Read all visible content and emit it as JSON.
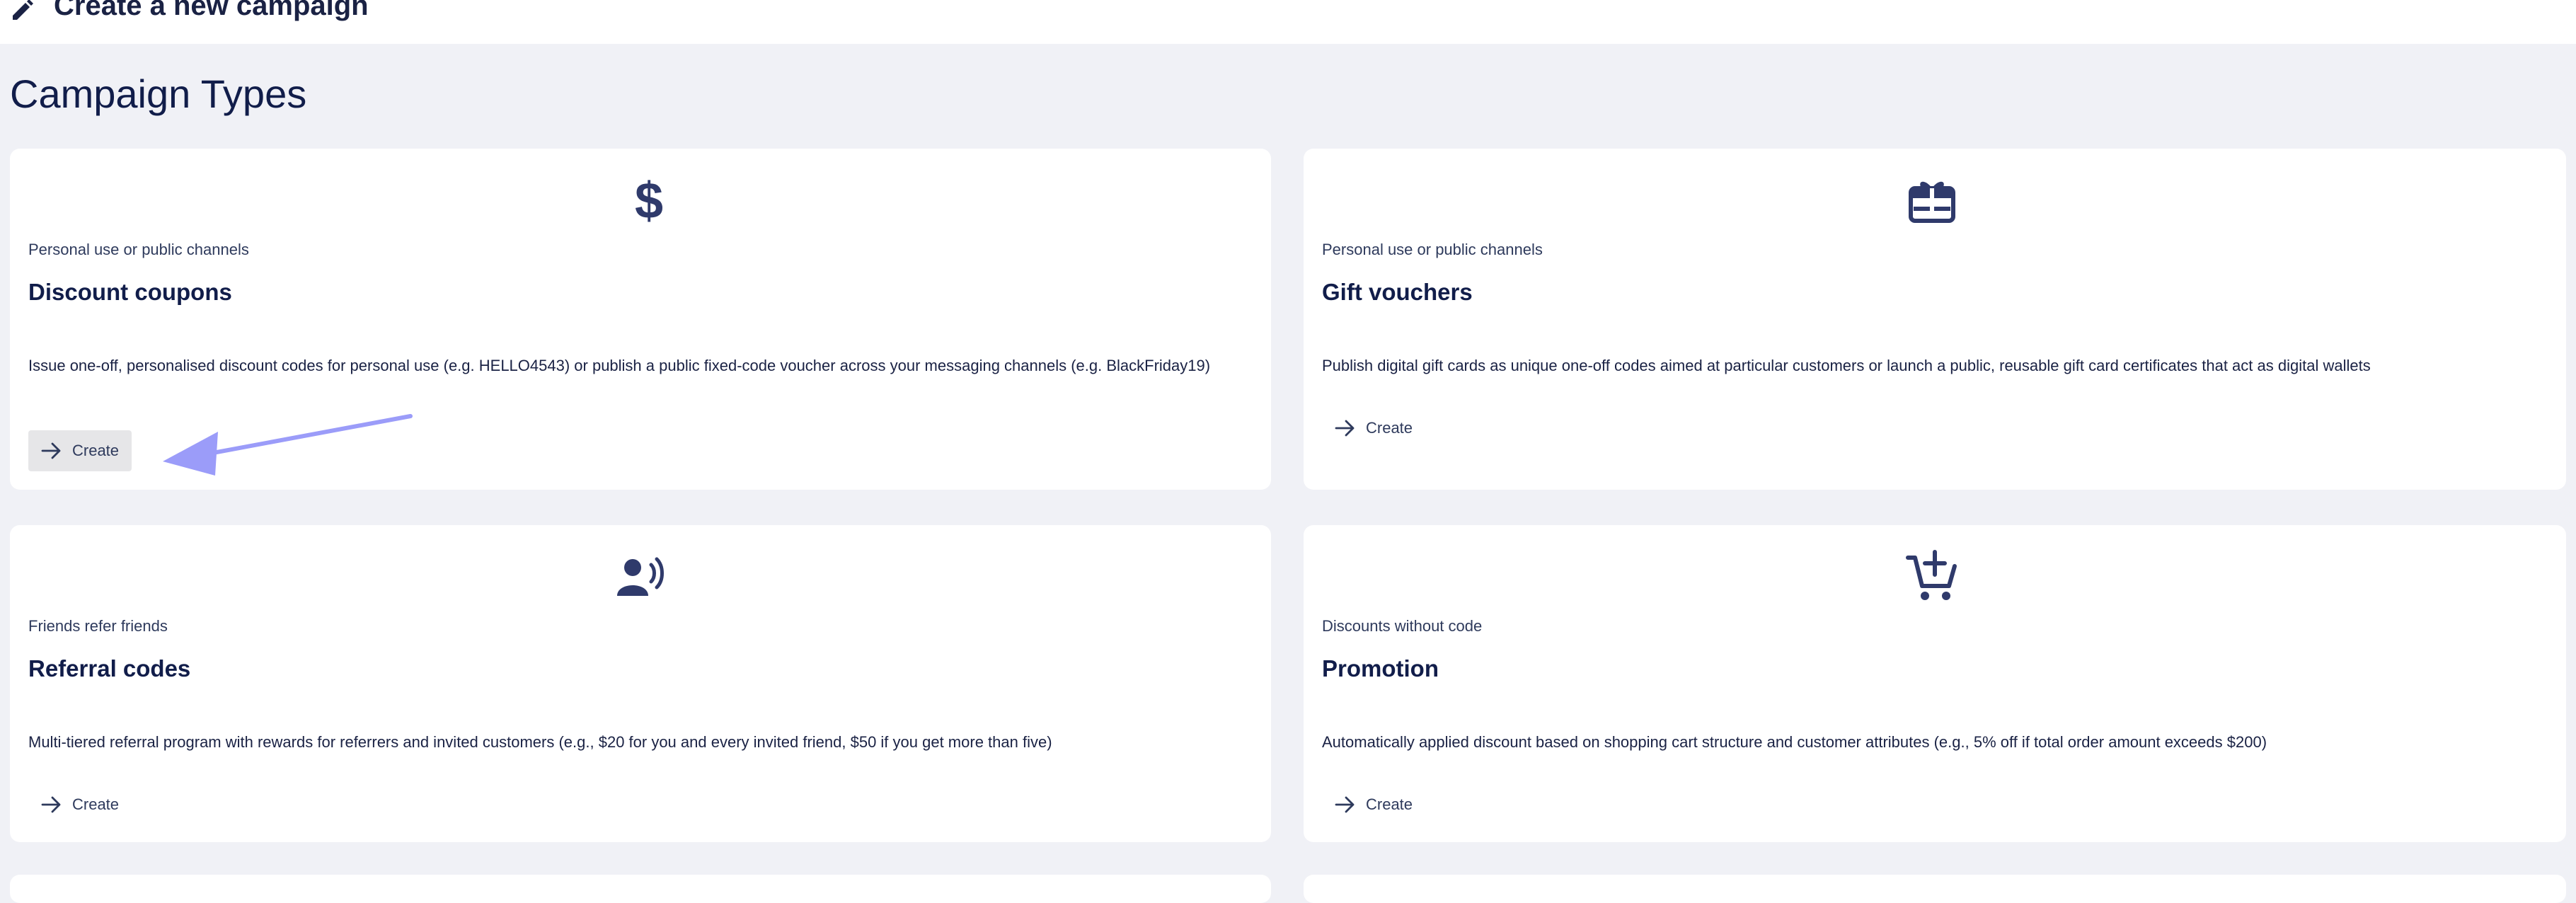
{
  "header": {
    "title": "Create a new campaign",
    "icon": "pencil-icon"
  },
  "section": {
    "title": "Campaign Types"
  },
  "colors": {
    "background": "#f0f1f6",
    "card": "#ffffff",
    "icon": "#2f3a6b",
    "text": "#111d4a",
    "annotation_arrow": "#9b9cf9",
    "button_hover": "#e6e6e8"
  },
  "cards": [
    {
      "icon": "dollar-icon",
      "subtitle": "Personal use or public channels",
      "title": "Discount coupons",
      "description": "Issue one-off, personalised discount codes for personal use (e.g. HELLO4543) or publish a public fixed-code voucher across your messaging channels (e.g. BlackFriday19)",
      "button_label": "Create",
      "button_icon": "arrow-right-icon"
    },
    {
      "icon": "gift-card-icon",
      "subtitle": "Personal use or public channels",
      "title": "Gift vouchers",
      "description": "Publish digital gift cards as unique one-off codes aimed at particular customers or launch a public, reusable gift card certificates that act as digital wallets",
      "button_label": "Create",
      "button_icon": "arrow-right-icon"
    },
    {
      "icon": "referral-speaker-icon",
      "subtitle": "Friends refer friends",
      "title": "Referral codes",
      "description": "Multi-tiered referral program with rewards for referrers and invited customers (e.g., $20 for you and every invited friend, $50 if you get more than five)",
      "button_label": "Create",
      "button_icon": "arrow-right-icon"
    },
    {
      "icon": "cart-add-icon",
      "subtitle": "Discounts without code",
      "title": "Promotion",
      "description": "Automatically applied discount based on shopping cart structure and customer attributes (e.g., 5% off if total order amount exceeds $200)",
      "button_label": "Create",
      "button_icon": "arrow-right-icon"
    }
  ]
}
